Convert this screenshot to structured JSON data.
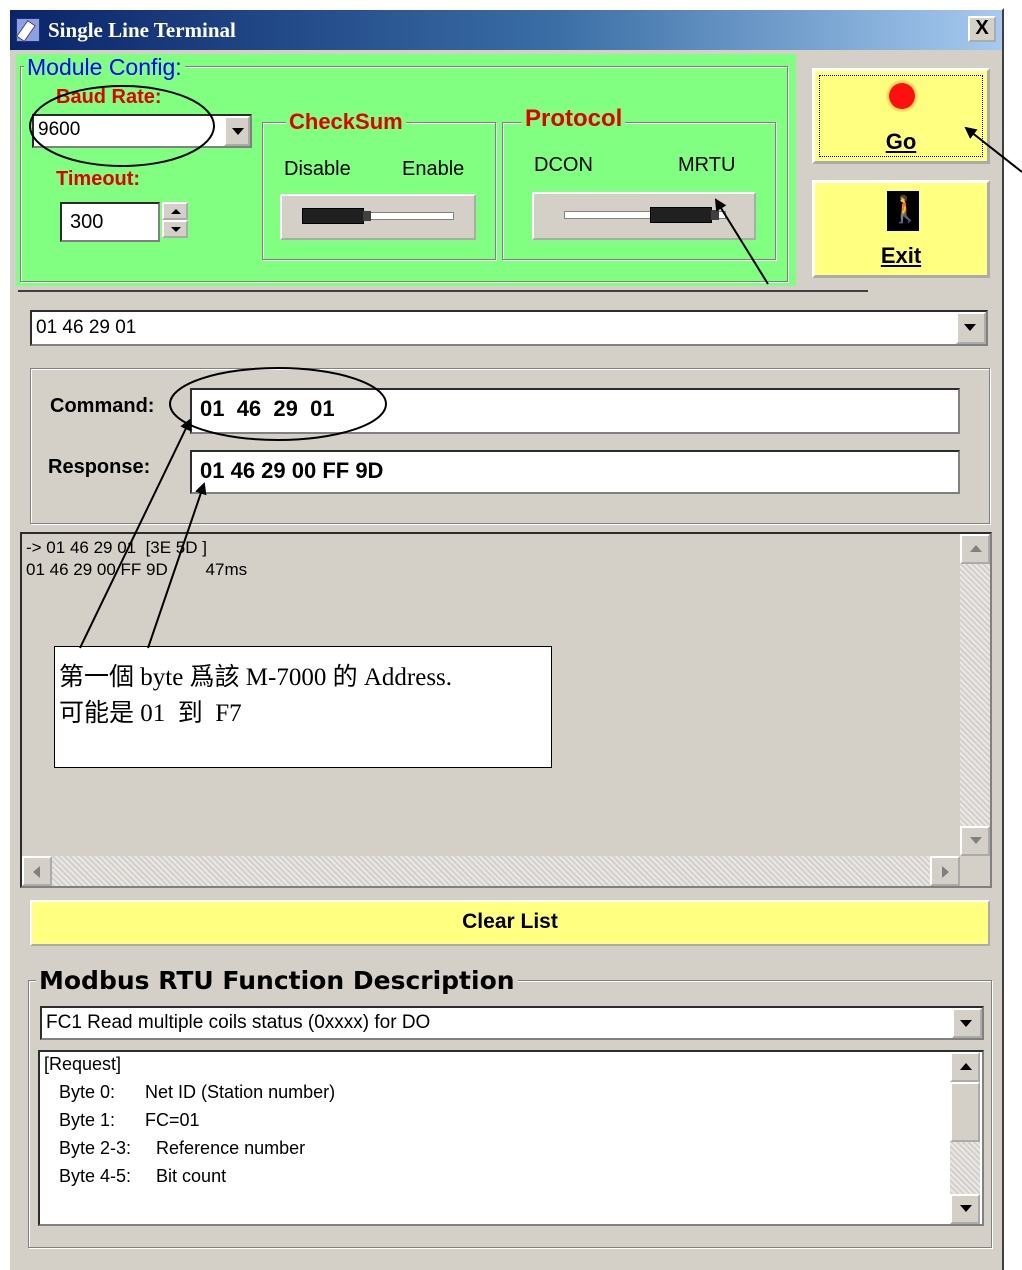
{
  "window": {
    "title": "Single Line Terminal",
    "close_label": "X"
  },
  "module_config": {
    "legend": "Module Config:",
    "baud_rate": {
      "label": "Baud Rate:",
      "value": "9600"
    },
    "timeout": {
      "label": "Timeout:",
      "value": "300"
    },
    "checksum": {
      "legend": "CheckSum",
      "left_label": "Disable",
      "right_label": "Enable",
      "selected": "Disable"
    },
    "protocol": {
      "legend": "Protocol",
      "left_label": "DCON",
      "right_label": "MRTU",
      "selected": "MRTU"
    }
  },
  "buttons": {
    "go_label": "Go",
    "exit_label": "Exit",
    "clear_label": "Clear List"
  },
  "command_history": {
    "value": "01 46 29 01"
  },
  "command": {
    "label": "Command:",
    "value": "01  46  29  01"
  },
  "response": {
    "label": "Response:",
    "value": "01 46 29 00 FF 9D"
  },
  "log": {
    "lines": [
      "-> 01 46 29 01  [3E 5D ]",
      "01 46 29 00 FF 9D        47ms"
    ]
  },
  "callout": {
    "lines": [
      "第一個 byte 爲該 M-7000 的 Address.",
      "可能是 01  到  F7"
    ]
  },
  "modbus": {
    "legend": "Modbus RTU Function Description",
    "function_selected": "FC1  Read multiple coils status (0xxxx)  for DO",
    "description_lines": [
      "[Request]",
      "   Byte 0:      Net ID (Station number)",
      "   Byte 1:      FC=01",
      "   Byte 2-3:     Reference number",
      "   Byte 4-5:     Bit count"
    ]
  },
  "colors": {
    "module_panel": "#80ff80",
    "button_yellow": "#ffff80",
    "label_red": "#e00000",
    "legend_blue": "#0000ff"
  }
}
